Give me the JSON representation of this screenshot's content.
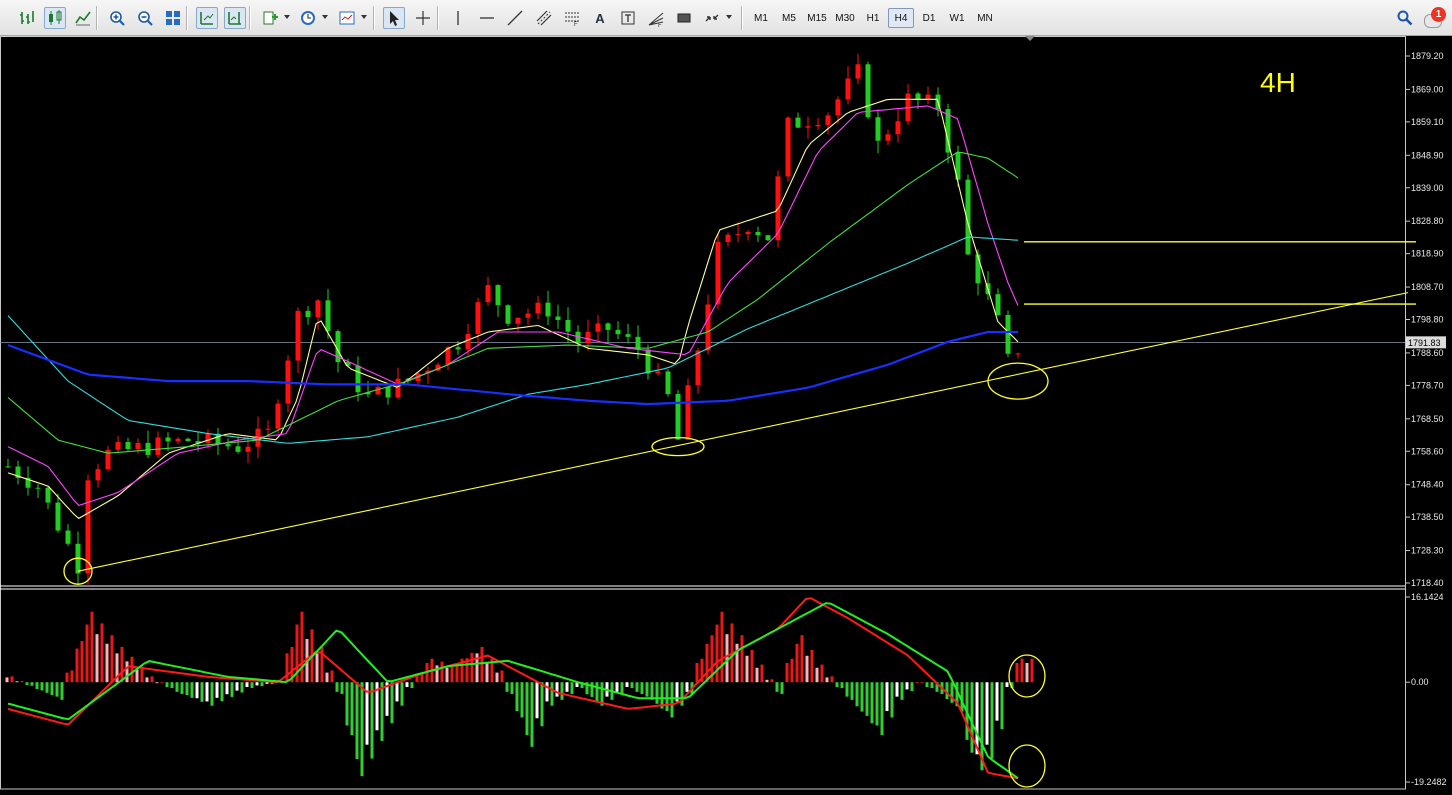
{
  "toolbar": {
    "groups": [
      [
        "bar-chart-icon",
        "candlestick-chart-icon",
        "line-chart-icon"
      ],
      [
        "zoom-in-icon",
        "zoom-out-icon",
        "tile-windows-icon"
      ],
      [
        "autoscroll-icon",
        "chart-shift-icon"
      ],
      [
        "indicators-icon",
        "periodicity-clock-icon",
        "templates-icon"
      ],
      [
        "cursor-icon",
        "crosshair-icon"
      ],
      [
        "vertical-line-icon",
        "horizontal-line-icon",
        "trendline-icon",
        "equidistant-channel-icon",
        "fibonacci-retracement-icon",
        "text-icon",
        "text-label-icon",
        "fibonacci-fan-icon",
        "rectangle-icon",
        "arrows-icon"
      ]
    ],
    "text_tool": "A",
    "timeframes": [
      "M1",
      "M5",
      "M15",
      "M30",
      "H1",
      "H4",
      "D1",
      "W1",
      "MN"
    ],
    "active_timeframe": "H4",
    "notification_count": "1"
  },
  "chart": {
    "timeframe_label": "4H",
    "current_price": "1791.83",
    "price_ticks": [
      "1879.20",
      "1869.00",
      "1859.10",
      "1848.90",
      "1839.00",
      "1828.80",
      "1818.90",
      "1808.70",
      "1798.80",
      "1788.60",
      "1778.70",
      "1768.50",
      "1758.60",
      "1748.40",
      "1738.50",
      "1728.30",
      "1718.40"
    ],
    "macd_ticks": [
      "16.1424",
      "0.00",
      "-19.2482"
    ],
    "colors": {
      "background": "#000000",
      "bull_candle": "#ff1010",
      "bear_candle": "#22cc22",
      "ema_fast": "#ffff99",
      "ema_mid": "#ff44ff",
      "ema_slow": "#44dd44",
      "ema_long": "#33dddd",
      "ema_200": "#1a2fff",
      "trendline": "#ffff33",
      "macd_line": "#ff1a1a",
      "signal_line": "#22ee22"
    }
  },
  "chart_data": {
    "type": "candlestick",
    "symbol_timeframe": "H4",
    "ylim": [
      1718.4,
      1879.2
    ],
    "current_price": 1791.83,
    "moving_averages": [
      {
        "name": "",
        "color": "#ffff99",
        "points": [
          [
            0,
            1752
          ],
          [
            4,
            1748
          ],
          [
            7,
            1738
          ],
          [
            11,
            1745
          ],
          [
            16,
            1758
          ],
          [
            22,
            1764
          ],
          [
            27,
            1762
          ],
          [
            29,
            1775
          ],
          [
            31,
            1800
          ],
          [
            34,
            1784
          ],
          [
            39,
            1778
          ],
          [
            44,
            1790
          ],
          [
            48,
            1795
          ],
          [
            53,
            1797
          ],
          [
            58,
            1790
          ],
          [
            64,
            1788
          ],
          [
            67,
            1785
          ],
          [
            68,
            1797
          ],
          [
            71,
            1826
          ],
          [
            77,
            1832
          ],
          [
            80,
            1852
          ],
          [
            84,
            1862
          ],
          [
            88,
            1866
          ],
          [
            93,
            1866
          ],
          [
            96,
            1828
          ],
          [
            99,
            1798
          ],
          [
            101,
            1792
          ]
        ]
      },
      {
        "name": "",
        "color": "#ff44ff",
        "points": [
          [
            0,
            1760
          ],
          [
            4,
            1754
          ],
          [
            7,
            1742
          ],
          [
            11,
            1746
          ],
          [
            17,
            1758
          ],
          [
            23,
            1762
          ],
          [
            28,
            1764
          ],
          [
            31,
            1790
          ],
          [
            34,
            1786
          ],
          [
            39,
            1779
          ],
          [
            44,
            1785
          ],
          [
            49,
            1795
          ],
          [
            55,
            1795
          ],
          [
            62,
            1790
          ],
          [
            68,
            1788
          ],
          [
            72,
            1810
          ],
          [
            77,
            1825
          ],
          [
            81,
            1850
          ],
          [
            85,
            1862
          ],
          [
            92,
            1864
          ],
          [
            95,
            1860
          ],
          [
            98,
            1828
          ],
          [
            100,
            1810
          ],
          [
            101,
            1803
          ]
        ]
      },
      {
        "name": "",
        "color": "#44dd44",
        "points": [
          [
            0,
            1775
          ],
          [
            5,
            1762
          ],
          [
            10,
            1758
          ],
          [
            18,
            1760
          ],
          [
            25,
            1762
          ],
          [
            33,
            1774
          ],
          [
            40,
            1780
          ],
          [
            48,
            1790
          ],
          [
            56,
            1791
          ],
          [
            64,
            1790
          ],
          [
            70,
            1795
          ],
          [
            75,
            1805
          ],
          [
            82,
            1822
          ],
          [
            90,
            1840
          ],
          [
            95,
            1850
          ],
          [
            98,
            1848
          ],
          [
            101,
            1842
          ]
        ]
      },
      {
        "name": "",
        "color": "#33dddd",
        "points": [
          [
            0,
            1800
          ],
          [
            6,
            1780
          ],
          [
            12,
            1768
          ],
          [
            20,
            1764
          ],
          [
            28,
            1761
          ],
          [
            36,
            1763
          ],
          [
            45,
            1769
          ],
          [
            52,
            1776
          ],
          [
            58,
            1779
          ],
          [
            66,
            1784
          ],
          [
            74,
            1796
          ],
          [
            82,
            1806
          ],
          [
            90,
            1816
          ],
          [
            96,
            1824
          ],
          [
            101,
            1823
          ]
        ]
      },
      {
        "name": "",
        "color": "#1a2fff",
        "points": [
          [
            0,
            1791
          ],
          [
            8,
            1782
          ],
          [
            16,
            1780
          ],
          [
            24,
            1780
          ],
          [
            32,
            1779
          ],
          [
            40,
            1779
          ],
          [
            50,
            1776
          ],
          [
            58,
            1774
          ],
          [
            64,
            1773
          ],
          [
            72,
            1774
          ],
          [
            80,
            1778
          ],
          [
            88,
            1785
          ],
          [
            94,
            1792
          ],
          [
            98,
            1795
          ],
          [
            101,
            1795
          ]
        ]
      }
    ],
    "horizontal_lines": [
      1822.5,
      1803.5
    ],
    "trendline": [
      [
        7,
        1722
      ],
      [
        140,
        1807
      ]
    ],
    "highlighted_lows": [
      [
        7,
        1722
      ],
      [
        67,
        1760
      ],
      [
        101,
        1780
      ]
    ],
    "macd": {
      "ylim": [
        -19.2482,
        16.1424
      ],
      "histogram_pattern": "positive lobes near bars 8, 29, 48, 71, 80; negative lobes near bars 35, 52, 66, 87, 97; latest bar turning positive",
      "macd_line": [
        [
          0,
          -5
        ],
        [
          6,
          -8
        ],
        [
          12,
          3
        ],
        [
          20,
          1
        ],
        [
          27,
          0
        ],
        [
          31,
          6
        ],
        [
          36,
          -2
        ],
        [
          42,
          2
        ],
        [
          48,
          5
        ],
        [
          55,
          -2
        ],
        [
          62,
          -5
        ],
        [
          67,
          -4
        ],
        [
          71,
          4
        ],
        [
          77,
          10
        ],
        [
          80,
          16
        ],
        [
          84,
          12
        ],
        [
          90,
          5
        ],
        [
          95,
          -4
        ],
        [
          98,
          -17
        ],
        [
          101,
          -18
        ]
      ],
      "signal_line": [
        [
          0,
          -4
        ],
        [
          6,
          -7
        ],
        [
          14,
          4
        ],
        [
          22,
          1
        ],
        [
          28,
          0
        ],
        [
          33,
          10
        ],
        [
          38,
          0
        ],
        [
          44,
          3
        ],
        [
          50,
          4
        ],
        [
          57,
          0
        ],
        [
          63,
          -3
        ],
        [
          68,
          -3
        ],
        [
          73,
          6
        ],
        [
          78,
          11
        ],
        [
          82,
          15
        ],
        [
          88,
          9
        ],
        [
          94,
          2
        ],
        [
          98,
          -14
        ],
        [
          101,
          -18
        ]
      ]
    }
  }
}
